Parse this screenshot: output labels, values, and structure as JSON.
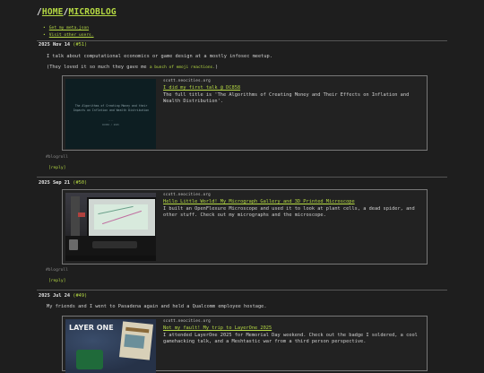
{
  "header": {
    "title_slash1": "/",
    "title_home": "HOME",
    "title_slash2": "/",
    "title_microblog": "MICROBLOG",
    "links": [
      "Get my meta.json",
      "Visit other users."
    ]
  },
  "posts": [
    {
      "date": "2025 Nov 14",
      "num": "(#51)",
      "lines": [
        "I talk about computational economics or game design at a mostly infosec meetup.",
        "(They loved it so much they gave me "
      ],
      "link_inline": "a bunch of emoji reactions.",
      "line2_end": ")",
      "card": {
        "site": "scott.neocities.org",
        "title": "I did my first talk @ DC858",
        "desc": "The full title is 'The Algorithms of Creating Money and Their Effects on Inflation and Wealth Distribution'.",
        "slide_title": "The Algorithms of Creating Money and their Impacts on Inflation and Wealth Distribution",
        "slide_sub1": "----",
        "slide_sub2": "DC858 / 2025"
      },
      "tags": "#blogroll",
      "reply": "[reply]"
    },
    {
      "date": "2025 Sep 21",
      "num": "(#50)",
      "card": {
        "site": "scott.neocities.org",
        "title": "Hello Little World! My Micrograph Gallery and 3D Printed Microscope",
        "desc": "I built an OpenFlexure Microscope and used it to look at plant cells, a dead spider, and other stuff. Check out my micrographs and the microscope."
      },
      "tags": "#blogroll",
      "reply": "[reply]"
    },
    {
      "date": "2025 Jul 24",
      "num": "(#49)",
      "lines": [
        "My friends and I went to Pasadena again and held a Qualcomm employee hostage."
      ],
      "card": {
        "site": "scott.neocities.org",
        "title": "Not my fault! My trip to LayerOne 2025",
        "desc": "I attended LayerOne 2025 for Memorial Day weekend. Check out the badge I soldered, a cool gamehacking talk, and a Meshtastic war from a third person perspective.",
        "photo_logo": "LAYER ONE"
      }
    }
  ],
  "colors": {
    "accent": "#b5d943",
    "background": "#1e1e1e",
    "text": "#d0d0d0"
  }
}
